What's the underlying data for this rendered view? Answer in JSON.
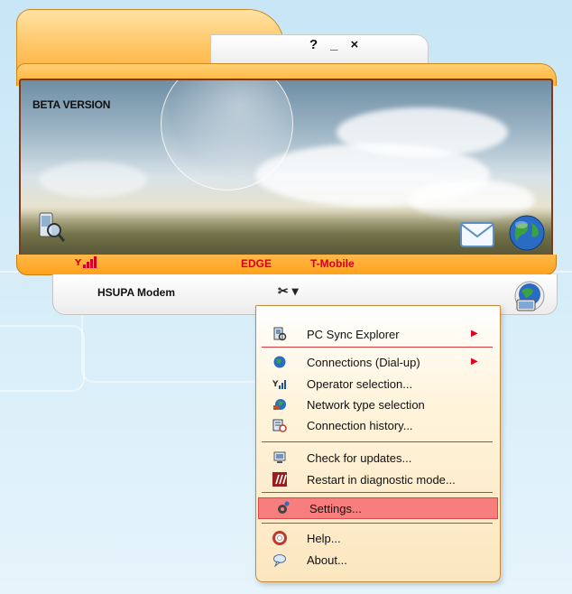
{
  "window": {
    "title_buttons": {
      "help": "?",
      "minimize": "_",
      "close": "×"
    },
    "banner": {
      "label": "BETA VERSION"
    },
    "status": {
      "signal_icon": "signal-bars-icon",
      "network_type": "EDGE",
      "operator": "T-Mobile"
    },
    "device_label": "HSUPA Modem",
    "tools_button": "✂ ▾"
  },
  "menu": {
    "items": [
      {
        "label": "PC Sync Explorer",
        "icon": "pc-sync-icon",
        "submenu": true
      },
      {
        "label": "Connections (Dial-up)",
        "icon": "connection-globe-icon",
        "submenu": true
      },
      {
        "label": "Operator selection...",
        "icon": "antenna-icon",
        "submenu": false
      },
      {
        "label": "Network type selection",
        "icon": "network-globe-icon",
        "submenu": false
      },
      {
        "label": "Connection history...",
        "icon": "history-icon",
        "submenu": false
      },
      {
        "label": "Check for updates...",
        "icon": "update-icon",
        "submenu": false
      },
      {
        "label": "Restart in diagnostic mode...",
        "icon": "diagnostic-icon",
        "submenu": false
      },
      {
        "label": "Settings...",
        "icon": "settings-gear-icon",
        "submenu": false,
        "selected": true
      },
      {
        "label": "Help...",
        "icon": "lifebuoy-icon",
        "submenu": false
      },
      {
        "label": "About...",
        "icon": "speech-bubble-icon",
        "submenu": false
      }
    ],
    "submenu_arrow": "▶"
  },
  "colors": {
    "accent_orange": "#ffb12f",
    "status_red": "#d6001e",
    "menu_highlight": "#f87e7e"
  }
}
